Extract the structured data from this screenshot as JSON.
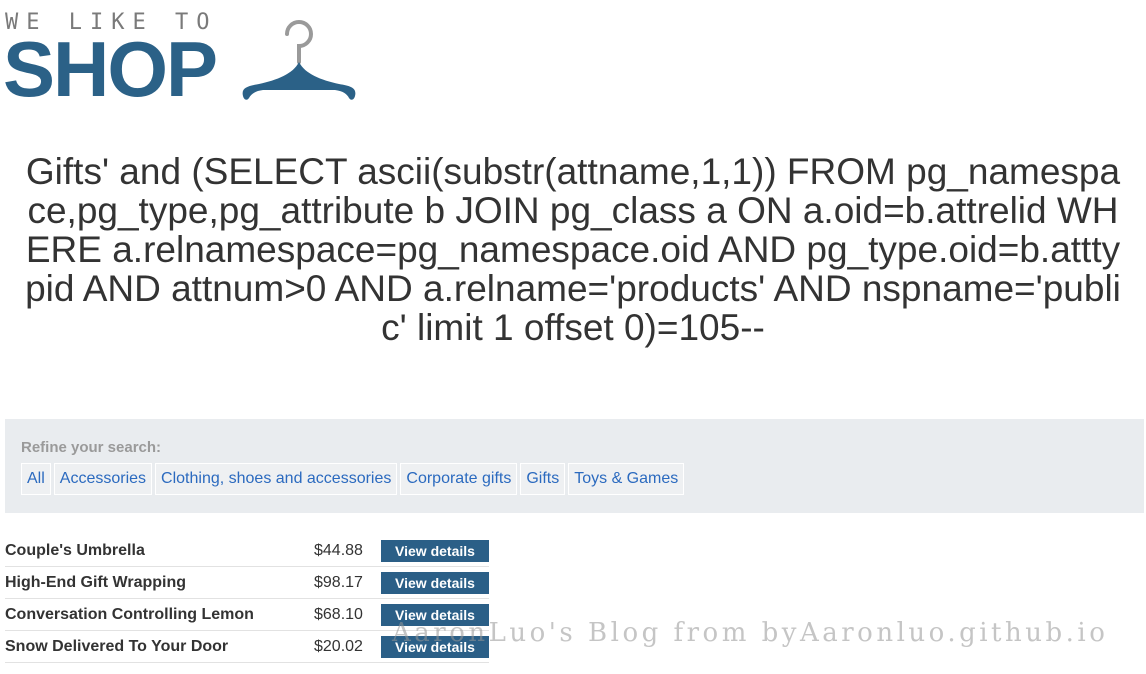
{
  "logo": {
    "tagline": "WE LIKE TO",
    "wordmark": "SHOP",
    "icon": "clothes-hanger-icon",
    "brand_color": "#2b6187"
  },
  "page": {
    "title": "Gifts' and (SELECT ascii(substr(attname,1,1)) FROM pg_namespace,pg_type,pg_attribute b JOIN pg_class a ON a.oid=b.attrelid WHERE a.relnamespace=pg_namespace.oid AND pg_type.oid=b.atttypid AND attnum>0 AND a.relname='products' AND nspname='public' limit 1 offset 0)=105--"
  },
  "filters": {
    "heading": "Refine your search:",
    "links": [
      {
        "label": "All"
      },
      {
        "label": "Accessories"
      },
      {
        "label": "Clothing, shoes and accessories"
      },
      {
        "label": "Corporate gifts"
      },
      {
        "label": "Gifts"
      },
      {
        "label": "Toys & Games"
      }
    ]
  },
  "products": [
    {
      "name": "Couple's Umbrella",
      "price": "$44.88",
      "button": "View details"
    },
    {
      "name": "High-End Gift Wrapping",
      "price": "$98.17",
      "button": "View details"
    },
    {
      "name": "Conversation Controlling Lemon",
      "price": "$68.10",
      "button": "View details"
    },
    {
      "name": "Snow Delivered To Your Door",
      "price": "$20.02",
      "button": "View details"
    }
  ],
  "watermark": "AaronLuo's Blog from byAaronluo.github.io",
  "colors": {
    "button_bg": "#2b5f87",
    "link": "#2b6abf",
    "panel_bg": "#e9ecef"
  }
}
